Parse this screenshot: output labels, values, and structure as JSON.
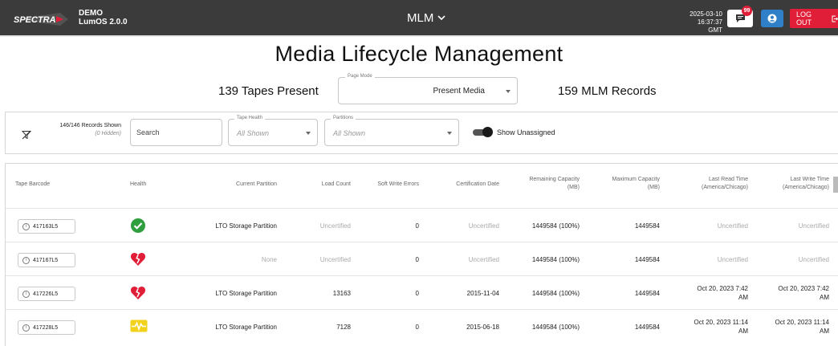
{
  "topbar": {
    "logo_text": "SPECTRA",
    "demo_label": "DEMO",
    "version": "LumOS 2.0.0",
    "app_name": "MLM",
    "date": "2025-03-10",
    "time": "16:37:37 GMT",
    "notification_count": "99",
    "logout_label": "LOG OUT"
  },
  "page": {
    "title": "Media Lifecycle Management",
    "tapes_present": "139 Tapes Present",
    "mlm_records": "159 MLM Records",
    "page_mode_label": "Page Mode",
    "page_mode_value": "Present Media"
  },
  "filters": {
    "records_shown": "146/146 Records Shown",
    "hidden": "(0 Hidden)",
    "search_placeholder": "Search",
    "tape_health_label": "Tape Health",
    "tape_health_value": "All Shown",
    "partitions_label": "Partitions",
    "partitions_value": "All Shown",
    "show_unassigned_label": "Show Unassigned",
    "show_unassigned_on": true
  },
  "table": {
    "headers": {
      "barcode": "Tape Barcode",
      "health": "Health",
      "partition": "Current Partition",
      "load_count": "Load Count",
      "soft_write": "Soft Write Errors",
      "cert_date": "Certification Date",
      "remaining_1": "Remaining Capacity",
      "remaining_2": "(MB)",
      "max_1": "Maximum Capacity",
      "max_2": "(MB)",
      "last_read_1": "Last Read Time",
      "last_read_2": "(America/Chicago)",
      "last_write_1": "Last Write Time",
      "last_write_2": "(America/Chicago)"
    },
    "rows": [
      {
        "barcode": "417163L5",
        "health": "good",
        "partition": "LTO Storage Partition",
        "load_count": "Uncertified",
        "soft_write": "0",
        "cert_date": "Uncertified",
        "remaining": "1449584 (100%)",
        "max": "1449584",
        "last_read_1": "Uncertified",
        "last_read_2": "",
        "last_write_1": "Uncertified",
        "last_write_2": ""
      },
      {
        "barcode": "417167L5",
        "health": "bad",
        "partition": "None",
        "load_count": "Uncertified",
        "soft_write": "0",
        "cert_date": "Uncertified",
        "remaining": "1449584 (100%)",
        "max": "1449584",
        "last_read_1": "Uncertified",
        "last_read_2": "",
        "last_write_1": "Uncertified",
        "last_write_2": ""
      },
      {
        "barcode": "417226L5",
        "health": "bad",
        "partition": "LTO Storage Partition",
        "load_count": "13163",
        "soft_write": "0",
        "cert_date": "2015-11-04",
        "remaining": "1449584 (100%)",
        "max": "1449584",
        "last_read_1": "Oct 20, 2023 7:42",
        "last_read_2": "AM",
        "last_write_1": "Oct 20, 2023 7:42",
        "last_write_2": "AM"
      },
      {
        "barcode": "417228L5",
        "health": "warning",
        "partition": "LTO Storage Partition",
        "load_count": "7128",
        "soft_write": "0",
        "cert_date": "2015-06-18",
        "remaining": "1449584 (100%)",
        "max": "1449584",
        "last_read_1": "Oct 20, 2023 11:14",
        "last_read_2": "AM",
        "last_write_1": "Oct 20, 2023 11:14",
        "last_write_2": "AM"
      }
    ]
  },
  "colors": {
    "topbar": "#3b3b3b",
    "health_good": "#2e9e3f",
    "health_bad": "#e01e37",
    "health_warning": "#f2d21b",
    "logout": "#e01e37",
    "user_button": "#2f80c8"
  }
}
